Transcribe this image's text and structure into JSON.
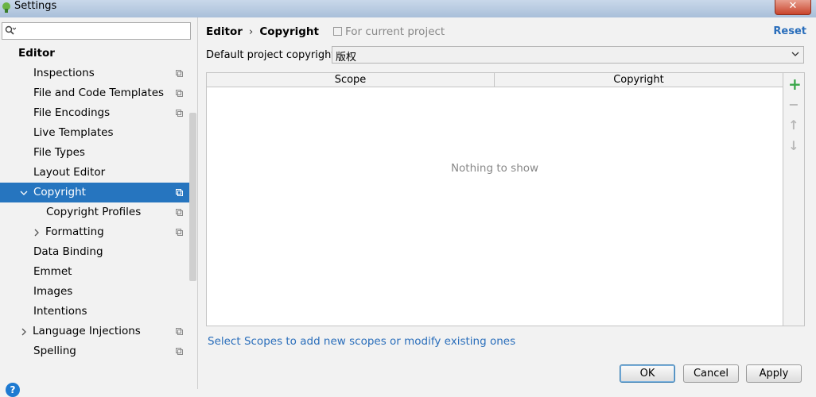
{
  "window": {
    "title": "Settings",
    "close_glyph": "✕"
  },
  "search": {
    "placeholder": ""
  },
  "sidebar": {
    "header": "Editor",
    "items": [
      {
        "label": "Inspections",
        "has_scope_icon": true
      },
      {
        "label": "File and Code Templates",
        "has_scope_icon": true
      },
      {
        "label": "File Encodings",
        "has_scope_icon": true
      },
      {
        "label": "Live Templates",
        "has_scope_icon": false
      },
      {
        "label": "File Types",
        "has_scope_icon": false
      },
      {
        "label": "Layout Editor",
        "has_scope_icon": false
      },
      {
        "label": "Copyright",
        "has_scope_icon": true,
        "selected": true,
        "expanded": true
      },
      {
        "label": "Copyright Profiles",
        "has_scope_icon": true
      },
      {
        "label": "Formatting",
        "has_scope_icon": true,
        "collapsed": true
      },
      {
        "label": "Data Binding",
        "has_scope_icon": false
      },
      {
        "label": "Emmet",
        "has_scope_icon": false
      },
      {
        "label": "Images",
        "has_scope_icon": false
      },
      {
        "label": "Intentions",
        "has_scope_icon": false
      },
      {
        "label": "Language Injections",
        "has_scope_icon": true,
        "collapsed": true
      },
      {
        "label": "Spelling",
        "has_scope_icon": true
      }
    ]
  },
  "breadcrumb": {
    "parent": "Editor",
    "separator": "›",
    "current": "Copyright",
    "hint": "For current project"
  },
  "reset_label": "Reset",
  "default_copyright": {
    "label": "Default project copyright:",
    "value": "版权"
  },
  "table": {
    "columns": [
      "Scope",
      "Copyright"
    ],
    "empty_text": "Nothing to show"
  },
  "toolbar": {
    "add": "+",
    "remove": "−",
    "up": "↑",
    "down": "↓"
  },
  "link_text": "Select Scopes to add new scopes or modify existing ones",
  "buttons": {
    "ok": "OK",
    "cancel": "Cancel",
    "apply": "Apply"
  },
  "help_glyph": "?",
  "colors": {
    "selection": "#2675bf",
    "link": "#2a6ebb",
    "add": "#3aa74a"
  }
}
